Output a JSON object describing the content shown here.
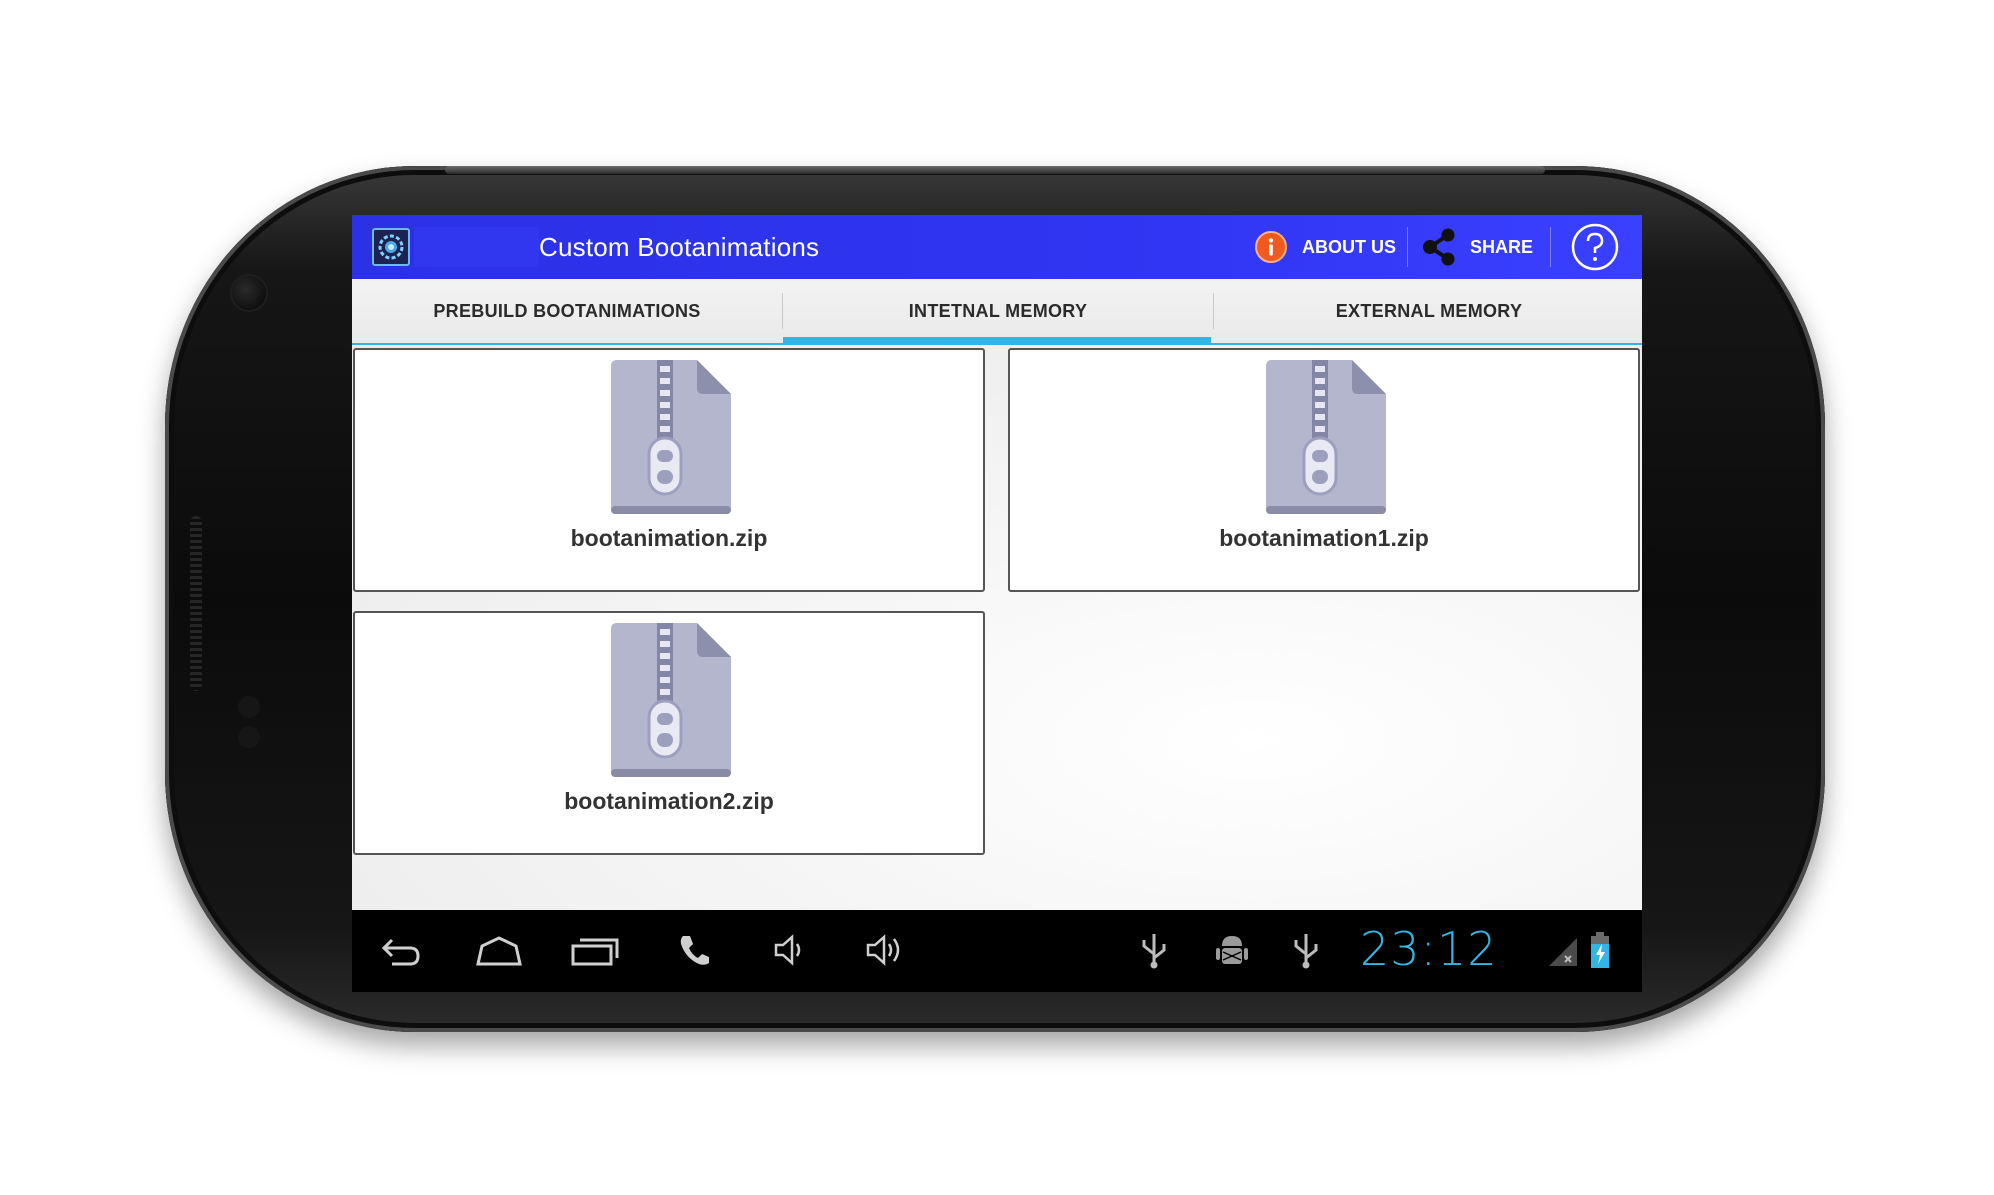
{
  "app": {
    "title": "Custom Bootanimations",
    "about_label": "ABOUT US",
    "share_label": "SHARE"
  },
  "tabs": [
    {
      "label": "PREBUILD BOOTANIMATIONS",
      "selected": false
    },
    {
      "label": "INTETNAL MEMORY",
      "selected": true
    },
    {
      "label": "EXTERNAL MEMORY",
      "selected": false
    }
  ],
  "files": [
    {
      "name": "bootanimation.zip",
      "icon": "zip-file-icon"
    },
    {
      "name": "bootanimation1.zip",
      "icon": "zip-file-icon"
    },
    {
      "name": "bootanimation2.zip",
      "icon": "zip-file-icon"
    }
  ],
  "statusbar": {
    "time": "23:12"
  },
  "colors": {
    "action_bar": "#2f35f2",
    "tab_indicator": "#35b3e3",
    "clock": "#33b5e5",
    "about_icon": "#f05a1e"
  }
}
